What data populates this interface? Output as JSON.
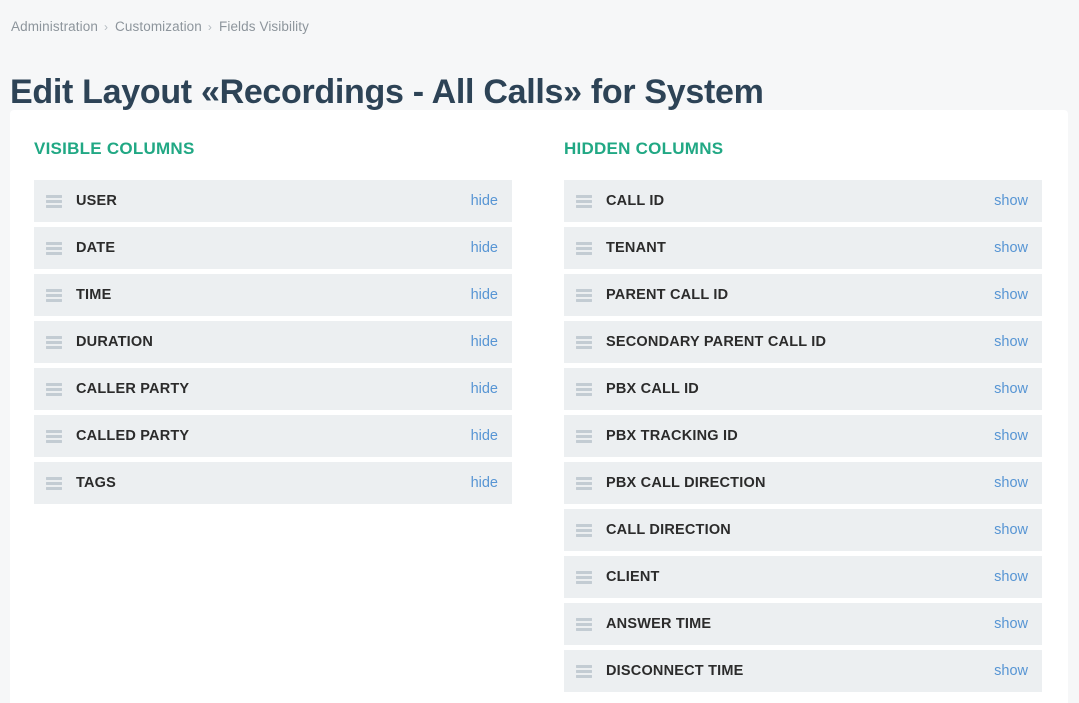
{
  "breadcrumb": {
    "separator": "›",
    "items": [
      {
        "label": "Administration"
      },
      {
        "label": "Customization"
      },
      {
        "label": "Fields Visibility"
      }
    ]
  },
  "page": {
    "title": "Edit Layout «Recordings - All Calls» for System"
  },
  "colors": {
    "heading_green": "#21a884",
    "link_blue": "#5795d4",
    "row_bg": "#eceff1",
    "title": "#2d4356",
    "breadcrumb": "#8d959c",
    "page_bg": "#f6f7f8",
    "card_bg": "#ffffff",
    "handle": "#c3ccd3"
  },
  "visible_columns": {
    "heading": "VISIBLE COLUMNS",
    "action_label": "hide",
    "handle_icon": "drag-handle-icon",
    "items": [
      {
        "label": "USER",
        "action": "hide"
      },
      {
        "label": "DATE",
        "action": "hide"
      },
      {
        "label": "TIME",
        "action": "hide"
      },
      {
        "label": "DURATION",
        "action": "hide"
      },
      {
        "label": "CALLER PARTY",
        "action": "hide"
      },
      {
        "label": "CALLED PARTY",
        "action": "hide"
      },
      {
        "label": "TAGS",
        "action": "hide"
      }
    ]
  },
  "hidden_columns": {
    "heading": "HIDDEN COLUMNS",
    "action_label": "show",
    "handle_icon": "drag-handle-icon",
    "items": [
      {
        "label": "CALL ID",
        "action": "show"
      },
      {
        "label": "TENANT",
        "action": "show"
      },
      {
        "label": "PARENT CALL ID",
        "action": "show"
      },
      {
        "label": "SECONDARY PARENT CALL ID",
        "action": "show"
      },
      {
        "label": "PBX CALL ID",
        "action": "show"
      },
      {
        "label": "PBX TRACKING ID",
        "action": "show"
      },
      {
        "label": "PBX CALL DIRECTION",
        "action": "show"
      },
      {
        "label": "CALL DIRECTION",
        "action": "show"
      },
      {
        "label": "CLIENT",
        "action": "show"
      },
      {
        "label": "ANSWER TIME",
        "action": "show"
      },
      {
        "label": "DISCONNECT TIME",
        "action": "show"
      }
    ]
  }
}
